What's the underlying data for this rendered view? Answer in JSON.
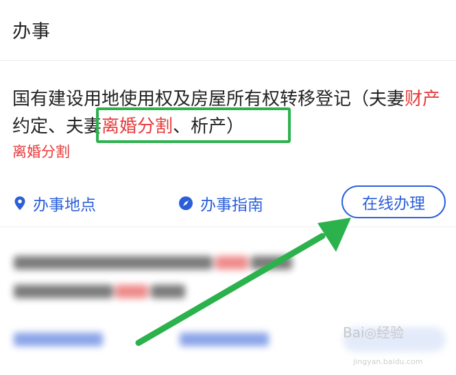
{
  "header": {
    "title": "办事"
  },
  "item": {
    "title_parts": [
      {
        "text": "国有建设用地使用权及房屋所有权转移登记（夫妻",
        "red": false
      },
      {
        "text": "财产",
        "red": true
      },
      {
        "text": "约定、",
        "red": false
      },
      {
        "text": "夫妻",
        "red": false
      },
      {
        "text": "离婚分割",
        "red": true
      },
      {
        "text": "、析产）",
        "red": false
      }
    ],
    "tag": "离婚分割"
  },
  "actions": {
    "location_label": "办事地点",
    "guide_label": "办事指南",
    "online_label": "在线办理"
  },
  "watermark": {
    "text": "Bai◎经验",
    "sub": "jingyan.baidu.com"
  },
  "colors": {
    "accent": "#2b5fd9",
    "highlight": "#e83a3a",
    "annotation": "#2bb24c"
  }
}
